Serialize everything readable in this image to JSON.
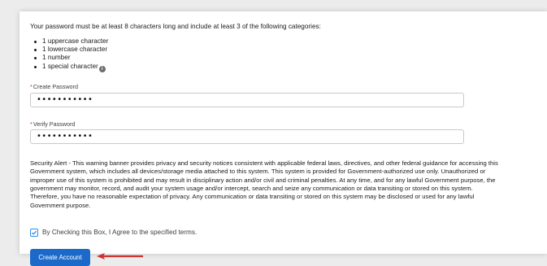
{
  "intro": "Your password must be at least 8 characters long and include at least 3 of the following categories:",
  "rules": [
    "1 uppercase character",
    "1 lowercase character",
    "1 number",
    "1 special character"
  ],
  "info_icon": "info-icon",
  "create_password": {
    "required_mark": "*",
    "label": "Create Password",
    "value": "•••••••••••"
  },
  "verify_password": {
    "required_mark": "*",
    "label": "Verify Password",
    "value": "•••••••••••"
  },
  "security_alert": "Security Alert - This warning banner provides privacy and security notices consistent with applicable federal laws, directives, and other federal guidance for accessing this Government system, which includes all devices/storage media attached to this system. This system is provided for Government-authorized use only. Unauthorized or improper use of this system is prohibited and may result in disciplinary action and/or civil and criminal penalties. At any time, and for any lawful Government purpose, the government may monitor, record, and audit your system usage and/or intercept, search and seize any communication or data transiting or stored on this system. Therefore, you have no reasonable expectation of privacy. Any communication or data transiting or stored on this system may be disclosed or used for any lawful Government purpose.",
  "agree_checkbox": {
    "checked": true,
    "label": "By Checking this Box, I Agree to the specified terms."
  },
  "create_account_button": "Create Account",
  "annotation_arrow_color": "#d0302b",
  "colors": {
    "button": "#1b6ac9",
    "required": "#c23934",
    "checkbox": "#2d8ce8"
  }
}
